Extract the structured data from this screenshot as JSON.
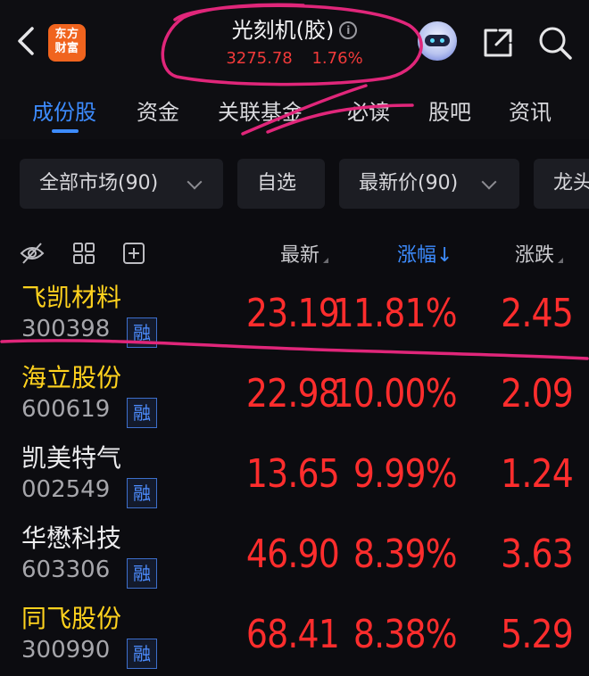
{
  "header": {
    "logo_line1": "东方",
    "logo_line2": "财富",
    "title": "光刻机(胶)",
    "info_glyph": "i",
    "index_value": "3275.78",
    "index_change_pct": "1.76%"
  },
  "tabs": [
    {
      "label": "成份股",
      "active": true
    },
    {
      "label": "资金"
    },
    {
      "label": "关联基金"
    },
    {
      "label": "必读"
    },
    {
      "label": "股吧"
    },
    {
      "label": "资讯"
    }
  ],
  "filters": [
    {
      "label": "全部市场(90)",
      "dropdown": true
    },
    {
      "label": "自选",
      "dropdown": false
    },
    {
      "label": "最新价(90)",
      "dropdown": true
    },
    {
      "label": "龙头",
      "dropdown": false
    }
  ],
  "columns": {
    "latest": "最新",
    "pct": "涨幅↓",
    "change": "涨跌"
  },
  "stocks": [
    {
      "name": "飞凯材料",
      "code": "300398",
      "badge": "融",
      "price": "23.19",
      "pct": "11.81%",
      "change": "2.45",
      "highlight": true
    },
    {
      "name": "海立股份",
      "code": "600619",
      "badge": "融",
      "price": "22.98",
      "pct": "10.00%",
      "change": "2.09",
      "highlight": true
    },
    {
      "name": "凯美特气",
      "code": "002549",
      "badge": "融",
      "price": "13.65",
      "pct": "9.99%",
      "change": "1.24",
      "highlight": false
    },
    {
      "name": "华懋科技",
      "code": "603306",
      "badge": "融",
      "price": "46.90",
      "pct": "8.39%",
      "change": "3.63",
      "highlight": false
    },
    {
      "name": "同飞股份",
      "code": "300990",
      "badge": "融",
      "price": "68.41",
      "pct": "8.38%",
      "change": "5.29",
      "highlight": true
    }
  ],
  "colors": {
    "up_red": "#ff2d2d",
    "accent_blue": "#3d8cff",
    "highlight_yellow": "#ffd21e",
    "annotation_pink": "#e0267a",
    "logo_orange": "#f0641e"
  }
}
